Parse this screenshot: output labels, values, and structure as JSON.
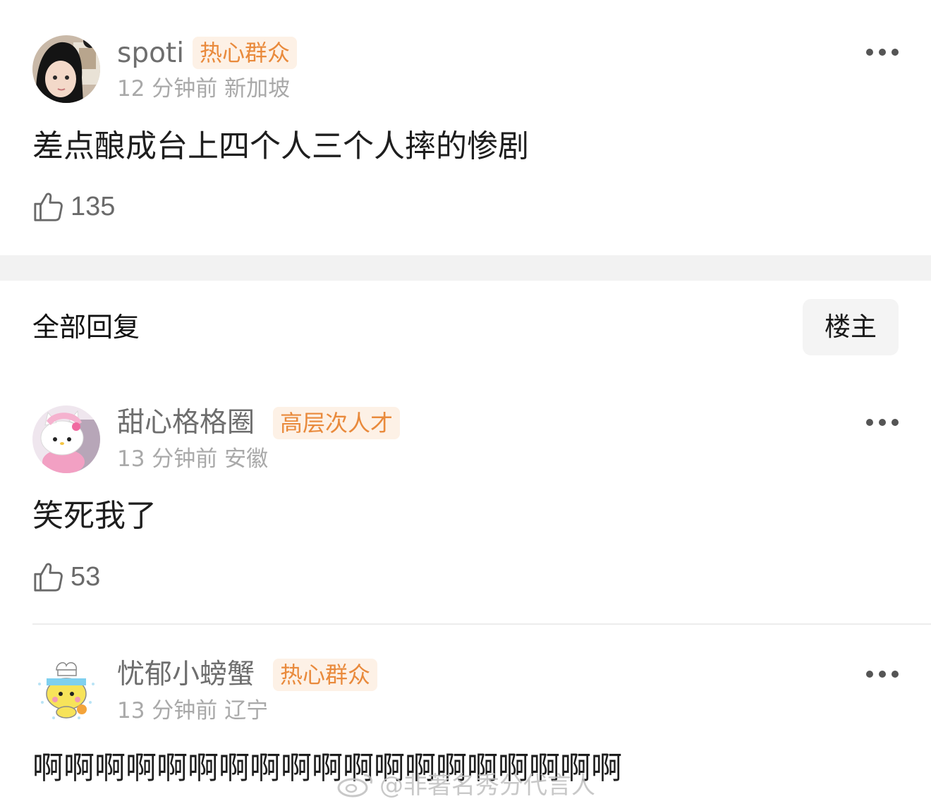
{
  "posts": [
    {
      "username": "spoti",
      "badge": "热心群众",
      "meta": "12 分钟前 新加坡",
      "content": "差点酿成台上四个人三个人摔的惨剧",
      "likes": "135",
      "avatar_icon": "girl-portrait-avatar"
    },
    {
      "username": "甜心格格圈",
      "badge": "高层次人才",
      "meta": "13 分钟前 安徽",
      "content": "笑死我了",
      "likes": "53",
      "avatar_icon": "hello-kitty-avatar"
    },
    {
      "username": "忧郁小螃蟹",
      "badge": "热心群众",
      "meta": "13 分钟前 辽宁",
      "content": "啊啊啊啊啊啊啊啊啊啊啊啊啊啊啊啊啊啊啊",
      "avatar_icon": "cartoon-bear-avatar"
    }
  ],
  "replies_section": {
    "title": "全部回复",
    "filter_label": "楼主"
  },
  "watermark": "@非著名秀分代言人",
  "colors": {
    "badge_text": "#e98a3c",
    "badge_bg": "#fdf1e6",
    "meta_text": "#a9a9a9",
    "separator": "#f2f2f2"
  }
}
